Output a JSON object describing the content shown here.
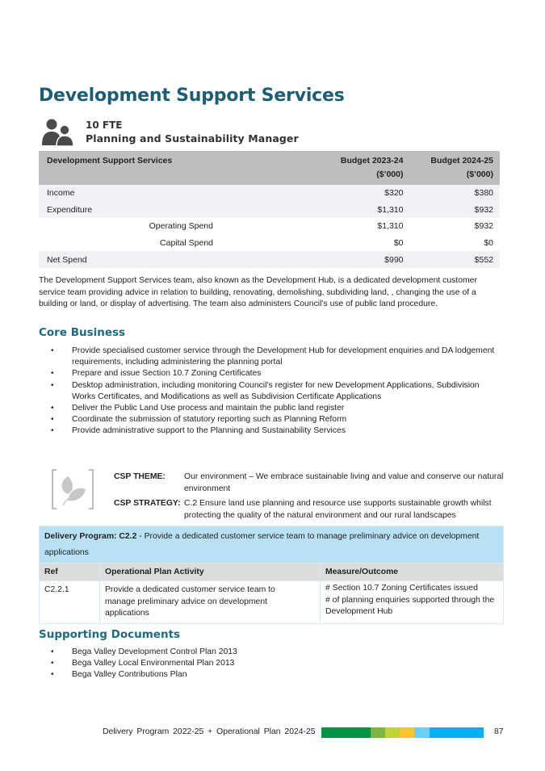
{
  "page": {
    "title": "Development Support Services",
    "fte_icon": "people-icon",
    "fte": "10 FTE",
    "manager": "Planning and Sustainability Manager"
  },
  "budget_table": {
    "headers": [
      "Development Support Services",
      "Budget 2023-24",
      "($’000)",
      "Budget 2024-25",
      "($’000)"
    ],
    "rows": [
      {
        "label": "Income",
        "y1": "$320",
        "y2": "$380"
      },
      {
        "label": "Expenditure",
        "y1": "$1,310",
        "y2": "$932"
      },
      {
        "label": "Operating Spend",
        "y1": "$1,310",
        "y2": "$932"
      },
      {
        "label": "Capital Spend",
        "y1": "$0",
        "y2": "$0"
      },
      {
        "label": "Net Spend",
        "y1": "$990",
        "y2": "$552"
      }
    ]
  },
  "description": "The Development Support Services team, also known as the Development Hub, is a dedicated development customer service team providing advice in relation to building, renovating, demolishing, subdividing land, , changing the use of a building or land, or display of advertising. The team also administers Council’s use of public land procedure.",
  "core_business": {
    "heading": "Core Business",
    "items": [
      "Provide specialised customer service through the Development Hub for development enquiries and DA lodgement requirements, including administering the planning portal",
      "Prepare and issue Section 10.7 Zoning Certificates",
      "Desktop administration, including monitoring Council’s register for new Development Applications, Subdivision Works Certificates,  and Modifications as well as Subdivision Certificate Applications",
      "Deliver the Public Land Use process and maintain the public land register",
      "Coordinate the submission of statutory reporting such as Planning Reform",
      "Provide administrative support to the Planning and Sustainability Services"
    ]
  },
  "csp": {
    "icon": "leaf-icon",
    "theme_label": "CSP THEME:",
    "theme_value": "Our environment – We embrace sustainable living and value and conserve our natural environment",
    "strategy_label": "CSP STRATEGY:",
    "strategy_value": "C.2 Ensure land use planning and resource use supports sustainable growth whilst protecting the quality of the natural environment and our rural landscapes"
  },
  "delivery": {
    "program_label": "Delivery Program: C2.2",
    "program_text": " - Provide a dedicated customer service team to manage preliminary advice on development applications",
    "headers": [
      "Ref",
      "Operational Plan Activity",
      "Measure/Outcome"
    ],
    "rows": [
      {
        "ref": "C2.2.1",
        "activity": "Provide a dedicated customer service team to manage preliminary advice on development applications",
        "measure": "# Section 10.7 Zoning Certificates issued\n# of planning enquiries supported through the Development Hub"
      }
    ]
  },
  "supporting_documents": {
    "heading": "Supporting Documents",
    "items": [
      "Bega Valley Development Control Plan 2013",
      "Bega Valley Local Environmental Plan 2013",
      "Bega Valley Contributions Plan"
    ]
  },
  "footer": {
    "text": "Delivery Program 2022-25 + Operational Plan 2024-25",
    "page_number": "87",
    "bar_colors": [
      "#009444",
      "#7cb742",
      "#bfd430",
      "#fcc52f",
      "#6ccff6",
      "#00b3ef"
    ]
  },
  "bullet_glyph": "•"
}
